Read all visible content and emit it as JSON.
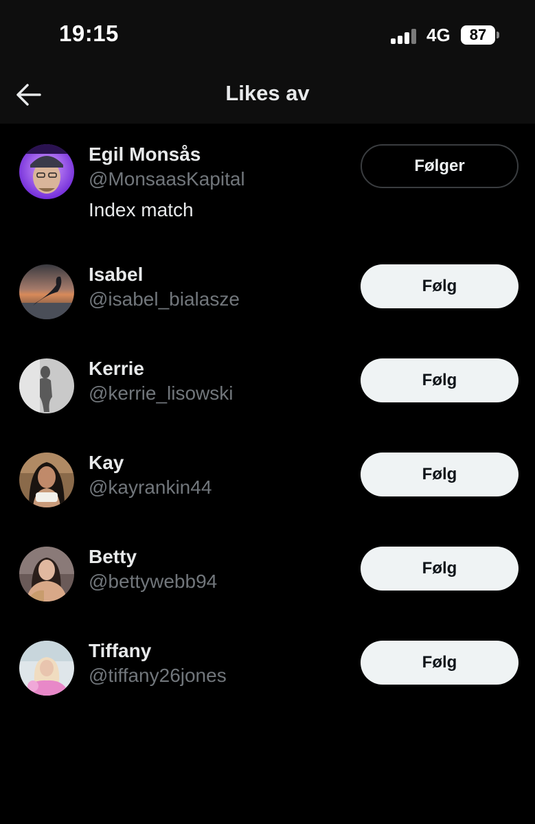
{
  "status_bar": {
    "time": "19:15",
    "network": "4G",
    "battery": "87"
  },
  "header": {
    "title": "Likes av",
    "back_icon": "arrow-left-icon"
  },
  "users": [
    {
      "name": "Egil Monsås",
      "handle": "@MonsaasKapital",
      "bio": "Index match",
      "button": "Følger",
      "following": true
    },
    {
      "name": "Isabel",
      "handle": "@isabel_bialasze",
      "button": "Følg",
      "following": false
    },
    {
      "name": "Kerrie",
      "handle": "@kerrie_lisowski",
      "button": "Følg",
      "following": false
    },
    {
      "name": "Kay",
      "handle": "@kayrankin44",
      "button": "Følg",
      "following": false
    },
    {
      "name": "Betty",
      "handle": "@bettywebb94",
      "button": "Følg",
      "following": false
    },
    {
      "name": "Tiffany",
      "handle": "@tiffany26jones",
      "button": "Følg",
      "following": false
    }
  ],
  "colors": {
    "background": "#000000",
    "text_primary": "#e7e9ea",
    "text_secondary": "#71767b",
    "button_light": "#eff3f4"
  }
}
